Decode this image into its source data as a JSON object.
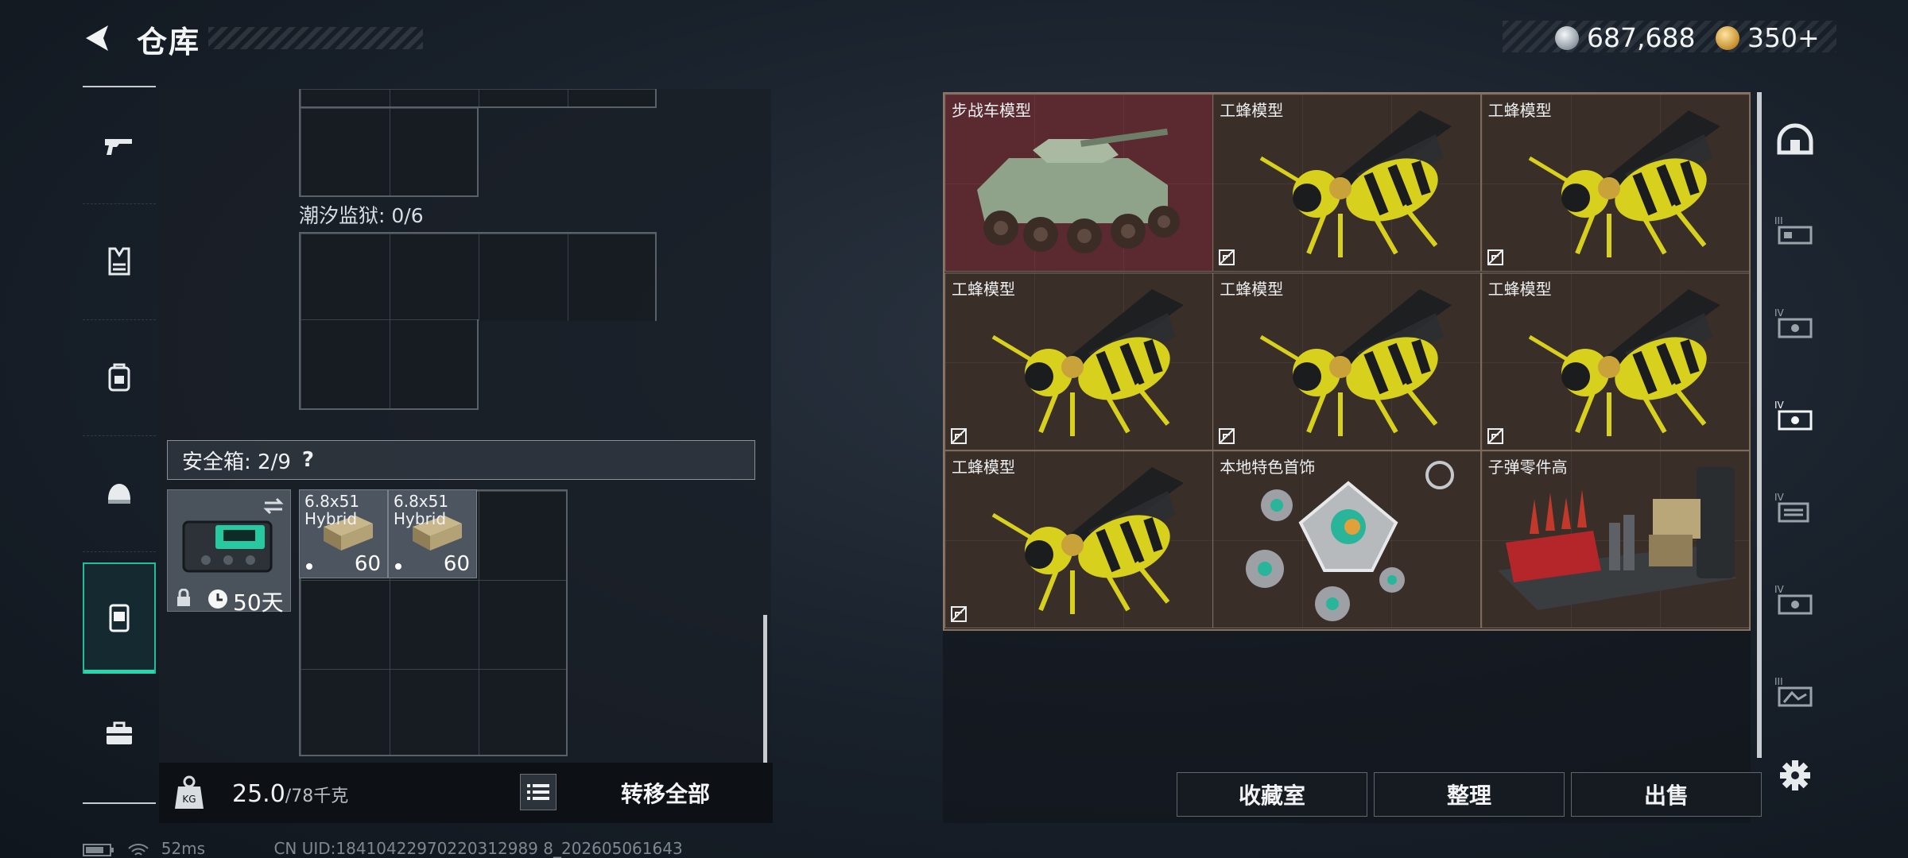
{
  "header": {
    "title": "仓库"
  },
  "currency": {
    "silver": "687,688",
    "gold": "350+"
  },
  "left_nav": {
    "items": [
      "weapon-icon",
      "armor-vest-icon",
      "backpack-icon",
      "helmet-icon",
      "safe-case-icon",
      "toolbox-icon"
    ],
    "active_index": 4
  },
  "storage": {
    "prison_label": "潮汐监狱: 0/6",
    "safe_label": "安全箱: 2/9",
    "help": "?",
    "case": {
      "days": "50天"
    },
    "ammo": [
      {
        "line1": "6.8x51",
        "line2": "Hybrid",
        "count": "60"
      },
      {
        "line1": "6.8x51",
        "line2": "Hybrid",
        "count": "60"
      }
    ]
  },
  "bottom_bar": {
    "weight": "25.0",
    "capacity": "/78千克",
    "transfer_all": "转移全部"
  },
  "items": [
    {
      "name": "步战车模型",
      "art": "vehicle",
      "highlight": true
    },
    {
      "name": "工蜂模型",
      "art": "bee"
    },
    {
      "name": "工蜂模型",
      "art": "bee"
    },
    {
      "name": "工蜂模型",
      "art": "bee"
    },
    {
      "name": "工蜂模型",
      "art": "bee"
    },
    {
      "name": "工蜂模型",
      "art": "bee"
    },
    {
      "name": "工蜂模型",
      "art": "bee"
    },
    {
      "name": "本地特色首饰",
      "art": "jewelry"
    },
    {
      "name": "子弹零件高",
      "art": "parts"
    }
  ],
  "actions": {
    "collection": "收藏室",
    "organize": "整理",
    "sell": "出售"
  },
  "right_nav": [
    "dome-icon",
    "tier3-gear-icon",
    "tier4-card-icon",
    "tier4-card-selected-icon",
    "tier4-docs-icon",
    "tier4-card-icon",
    "tier3-map-icon"
  ],
  "status": {
    "ping": "52ms",
    "uid": "CN UID:18410422970220312989 8_202605061643"
  }
}
